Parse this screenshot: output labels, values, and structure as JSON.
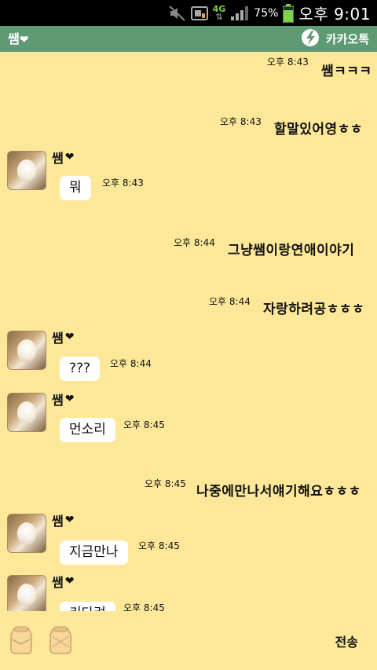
{
  "status_bar": {
    "battery_percent_text": "75%",
    "network": "4G",
    "time": "오후 9:01"
  },
  "header": {
    "title": "쌤",
    "title_heart": "❤",
    "brand": "카카오톡"
  },
  "messages": [
    {
      "type": "sent",
      "time": "오후 8:43",
      "text": "쌤ㅋㅋㅋ"
    },
    {
      "type": "sent",
      "time": "오후 8:43",
      "text": "할말있어영ㅎㅎ"
    },
    {
      "type": "received",
      "sender": "쌤",
      "time": "오후 8:43",
      "text": "뭐"
    },
    {
      "type": "sent",
      "time": "오후 8:44",
      "text": "그냥쌤이랑연애이야기"
    },
    {
      "type": "sent",
      "time": "오후 8:44",
      "text": "자랑하려공ㅎㅎㅎ"
    },
    {
      "type": "received",
      "sender": "쌤",
      "time": "오후 8:44",
      "text": "???"
    },
    {
      "type": "received",
      "sender": "쌤",
      "time": "오후 8:45",
      "text": "먼소리"
    },
    {
      "type": "sent",
      "time": "오후 8:45",
      "text": "나중에만나서얘기해요ㅎㅎㅎ"
    },
    {
      "type": "received",
      "sender": "쌤",
      "time": "오후 8:45",
      "text": "지금만나"
    },
    {
      "type": "received",
      "sender": "쌤",
      "time": "오후 8:45",
      "text": "키다려"
    }
  ],
  "input_bar": {
    "send_label": "전송"
  },
  "colors": {
    "chat_background": "#fde89a",
    "header_background": "#5e9a74",
    "bubble": "#ffffff",
    "battery": "#7cd24a"
  }
}
